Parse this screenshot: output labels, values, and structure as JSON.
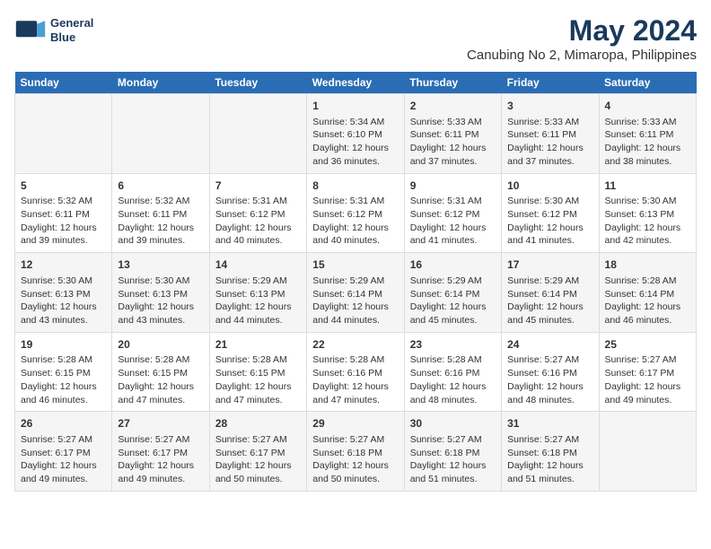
{
  "logo": {
    "line1": "General",
    "line2": "Blue"
  },
  "title": "May 2024",
  "subtitle": "Canubing No 2, Mimaropa, Philippines",
  "days_of_week": [
    "Sunday",
    "Monday",
    "Tuesday",
    "Wednesday",
    "Thursday",
    "Friday",
    "Saturday"
  ],
  "weeks": [
    [
      {
        "day": "",
        "info": ""
      },
      {
        "day": "",
        "info": ""
      },
      {
        "day": "",
        "info": ""
      },
      {
        "day": "1",
        "info": "Sunrise: 5:34 AM\nSunset: 6:10 PM\nDaylight: 12 hours and 36 minutes."
      },
      {
        "day": "2",
        "info": "Sunrise: 5:33 AM\nSunset: 6:11 PM\nDaylight: 12 hours and 37 minutes."
      },
      {
        "day": "3",
        "info": "Sunrise: 5:33 AM\nSunset: 6:11 PM\nDaylight: 12 hours and 37 minutes."
      },
      {
        "day": "4",
        "info": "Sunrise: 5:33 AM\nSunset: 6:11 PM\nDaylight: 12 hours and 38 minutes."
      }
    ],
    [
      {
        "day": "5",
        "info": "Sunrise: 5:32 AM\nSunset: 6:11 PM\nDaylight: 12 hours and 39 minutes."
      },
      {
        "day": "6",
        "info": "Sunrise: 5:32 AM\nSunset: 6:11 PM\nDaylight: 12 hours and 39 minutes."
      },
      {
        "day": "7",
        "info": "Sunrise: 5:31 AM\nSunset: 6:12 PM\nDaylight: 12 hours and 40 minutes."
      },
      {
        "day": "8",
        "info": "Sunrise: 5:31 AM\nSunset: 6:12 PM\nDaylight: 12 hours and 40 minutes."
      },
      {
        "day": "9",
        "info": "Sunrise: 5:31 AM\nSunset: 6:12 PM\nDaylight: 12 hours and 41 minutes."
      },
      {
        "day": "10",
        "info": "Sunrise: 5:30 AM\nSunset: 6:12 PM\nDaylight: 12 hours and 41 minutes."
      },
      {
        "day": "11",
        "info": "Sunrise: 5:30 AM\nSunset: 6:13 PM\nDaylight: 12 hours and 42 minutes."
      }
    ],
    [
      {
        "day": "12",
        "info": "Sunrise: 5:30 AM\nSunset: 6:13 PM\nDaylight: 12 hours and 43 minutes."
      },
      {
        "day": "13",
        "info": "Sunrise: 5:30 AM\nSunset: 6:13 PM\nDaylight: 12 hours and 43 minutes."
      },
      {
        "day": "14",
        "info": "Sunrise: 5:29 AM\nSunset: 6:13 PM\nDaylight: 12 hours and 44 minutes."
      },
      {
        "day": "15",
        "info": "Sunrise: 5:29 AM\nSunset: 6:14 PM\nDaylight: 12 hours and 44 minutes."
      },
      {
        "day": "16",
        "info": "Sunrise: 5:29 AM\nSunset: 6:14 PM\nDaylight: 12 hours and 45 minutes."
      },
      {
        "day": "17",
        "info": "Sunrise: 5:29 AM\nSunset: 6:14 PM\nDaylight: 12 hours and 45 minutes."
      },
      {
        "day": "18",
        "info": "Sunrise: 5:28 AM\nSunset: 6:14 PM\nDaylight: 12 hours and 46 minutes."
      }
    ],
    [
      {
        "day": "19",
        "info": "Sunrise: 5:28 AM\nSunset: 6:15 PM\nDaylight: 12 hours and 46 minutes."
      },
      {
        "day": "20",
        "info": "Sunrise: 5:28 AM\nSunset: 6:15 PM\nDaylight: 12 hours and 47 minutes."
      },
      {
        "day": "21",
        "info": "Sunrise: 5:28 AM\nSunset: 6:15 PM\nDaylight: 12 hours and 47 minutes."
      },
      {
        "day": "22",
        "info": "Sunrise: 5:28 AM\nSunset: 6:16 PM\nDaylight: 12 hours and 47 minutes."
      },
      {
        "day": "23",
        "info": "Sunrise: 5:28 AM\nSunset: 6:16 PM\nDaylight: 12 hours and 48 minutes."
      },
      {
        "day": "24",
        "info": "Sunrise: 5:27 AM\nSunset: 6:16 PM\nDaylight: 12 hours and 48 minutes."
      },
      {
        "day": "25",
        "info": "Sunrise: 5:27 AM\nSunset: 6:17 PM\nDaylight: 12 hours and 49 minutes."
      }
    ],
    [
      {
        "day": "26",
        "info": "Sunrise: 5:27 AM\nSunset: 6:17 PM\nDaylight: 12 hours and 49 minutes."
      },
      {
        "day": "27",
        "info": "Sunrise: 5:27 AM\nSunset: 6:17 PM\nDaylight: 12 hours and 49 minutes."
      },
      {
        "day": "28",
        "info": "Sunrise: 5:27 AM\nSunset: 6:17 PM\nDaylight: 12 hours and 50 minutes."
      },
      {
        "day": "29",
        "info": "Sunrise: 5:27 AM\nSunset: 6:18 PM\nDaylight: 12 hours and 50 minutes."
      },
      {
        "day": "30",
        "info": "Sunrise: 5:27 AM\nSunset: 6:18 PM\nDaylight: 12 hours and 51 minutes."
      },
      {
        "day": "31",
        "info": "Sunrise: 5:27 AM\nSunset: 6:18 PM\nDaylight: 12 hours and 51 minutes."
      },
      {
        "day": "",
        "info": ""
      }
    ]
  ]
}
